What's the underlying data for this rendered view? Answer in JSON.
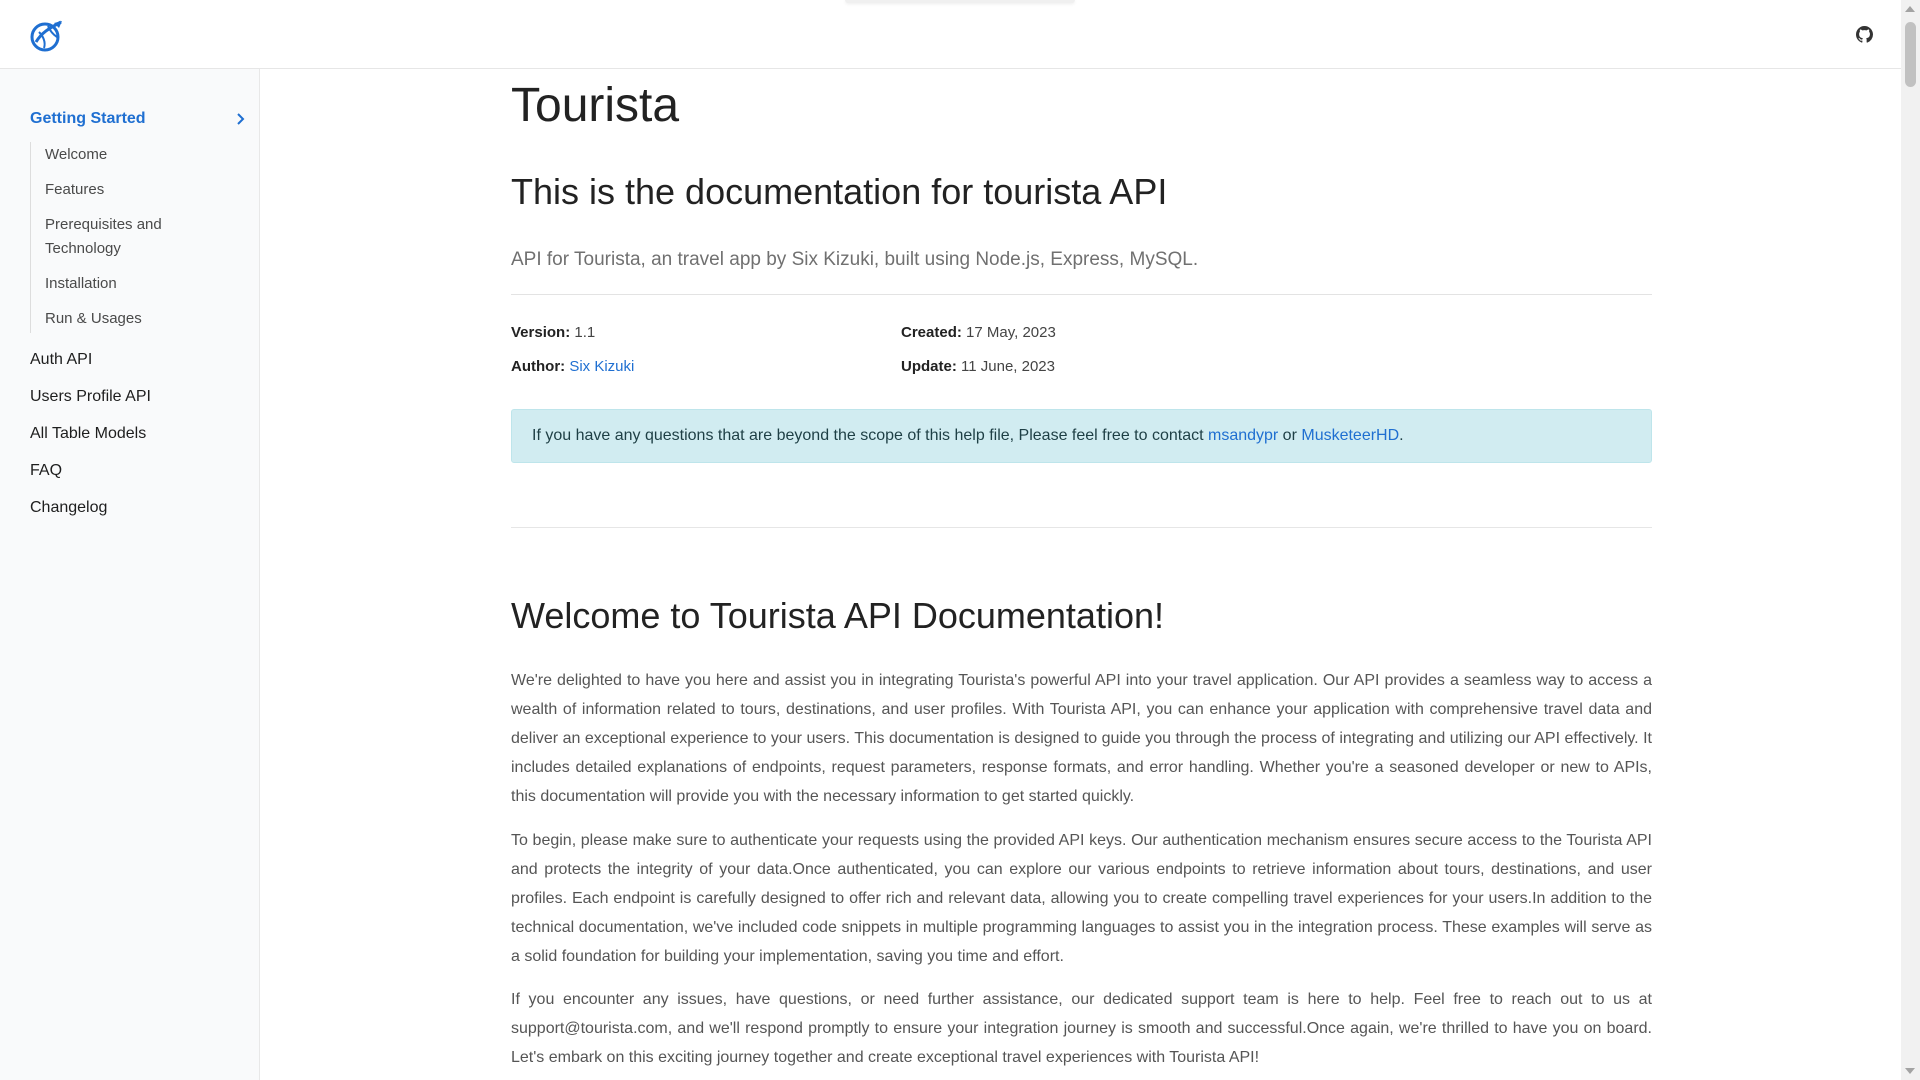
{
  "header": {
    "logo_icon": "globe-plane-logo-icon",
    "github_icon": "github-icon"
  },
  "sidebar": {
    "group": {
      "label": "Getting Started",
      "items": [
        "Welcome",
        "Features",
        "Prerequisites and Technology",
        "Installation",
        "Run & Usages"
      ]
    },
    "items": [
      "Auth API",
      "Users Profile API",
      "All Table Models",
      "FAQ",
      "Changelog"
    ]
  },
  "main": {
    "title": "Tourista",
    "subtitle": "This is the documentation for tourista API",
    "lead": "API for Tourista, an travel app by Six Kizuki, built using Node.js, Express, MySQL.",
    "meta": {
      "version_label": "Version:",
      "version": "1.1",
      "author_label": "Author:",
      "author": "Six Kizuki",
      "created_label": "Created:",
      "created": "17 May, 2023",
      "update_label": "Update:",
      "update": "11 June, 2023"
    },
    "alert": {
      "text": "If you have any questions that are beyond the scope of this help file, Please feel free to contact ",
      "link1": "msandypr",
      "or": " or ",
      "link2": "MusketeerHD",
      "end": "."
    },
    "welcome_heading": "Welcome to Tourista API Documentation!",
    "paragraphs": [
      "We're delighted to have you here and assist you in integrating Tourista's powerful API into your travel application. Our API provides a seamless way to access a wealth of information related to tours, destinations, and user profiles. With Tourista API, you can enhance your application with comprehensive travel data and deliver an exceptional experience to your users. This documentation is designed to guide you through the process of integrating and utilizing our API effectively. It includes detailed explanations of endpoints, request parameters, response formats, and error handling. Whether you're a seasoned developer or new to APIs, this documentation will provide you with the necessary information to get started quickly.",
      "To begin, please make sure to authenticate your requests using the provided API keys. Our authentication mechanism ensures secure access to the Tourista API and protects the integrity of your data.Once authenticated, you can explore our various endpoints to retrieve information about tours, destinations, and user profiles. Each endpoint is carefully designed to offer rich and relevant data, allowing you to create compelling travel experiences for your users.In addition to the technical documentation, we've included code snippets in multiple programming languages to assist you in the integration process. These examples will serve as a solid foundation for building your implementation, saving you time and effort.",
      "If you encounter any issues, have questions, or need further assistance, our dedicated support team is here to help. Feel free to reach out to us at support@tourista.com, and we'll respond promptly to ensure your integration journey is smooth and successful.Once again, we're thrilled to have you on board. Let's embark on this exciting journey together and create exceptional travel experiences with Tourista API!"
    ]
  },
  "colors": {
    "accent": "#1f6fd1",
    "alert_bg": "#d1ecf1",
    "sidebar_bg": "#f9fafb"
  }
}
